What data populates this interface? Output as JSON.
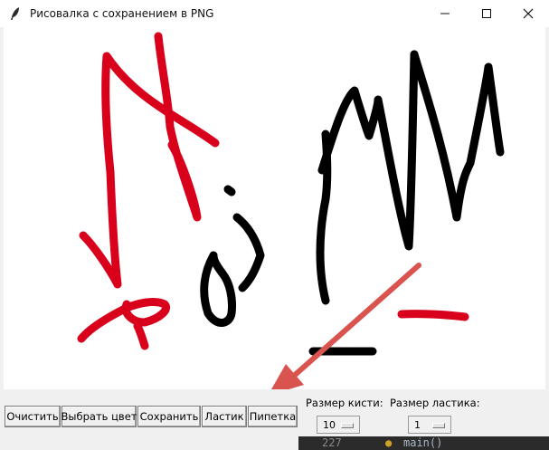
{
  "window": {
    "title": "Рисовалка с сохранением в PNG",
    "controls": [
      "minimize",
      "maximize",
      "close"
    ]
  },
  "toolbar": {
    "buttons": [
      "Очистить",
      "Выбрать цвет",
      "Сохранить",
      "Ластик",
      "Пипетка"
    ],
    "brush_size_label": "Размер кисти:",
    "brush_size_value": "10",
    "eraser_size_label": "Размер ластика:",
    "eraser_size_value": "1"
  },
  "colors": {
    "stroke_red": "#d9001b",
    "stroke_black": "#000000",
    "annotation_arrow": "#d9534f"
  },
  "background_editor": {
    "line_number": "227",
    "code": "main()"
  }
}
